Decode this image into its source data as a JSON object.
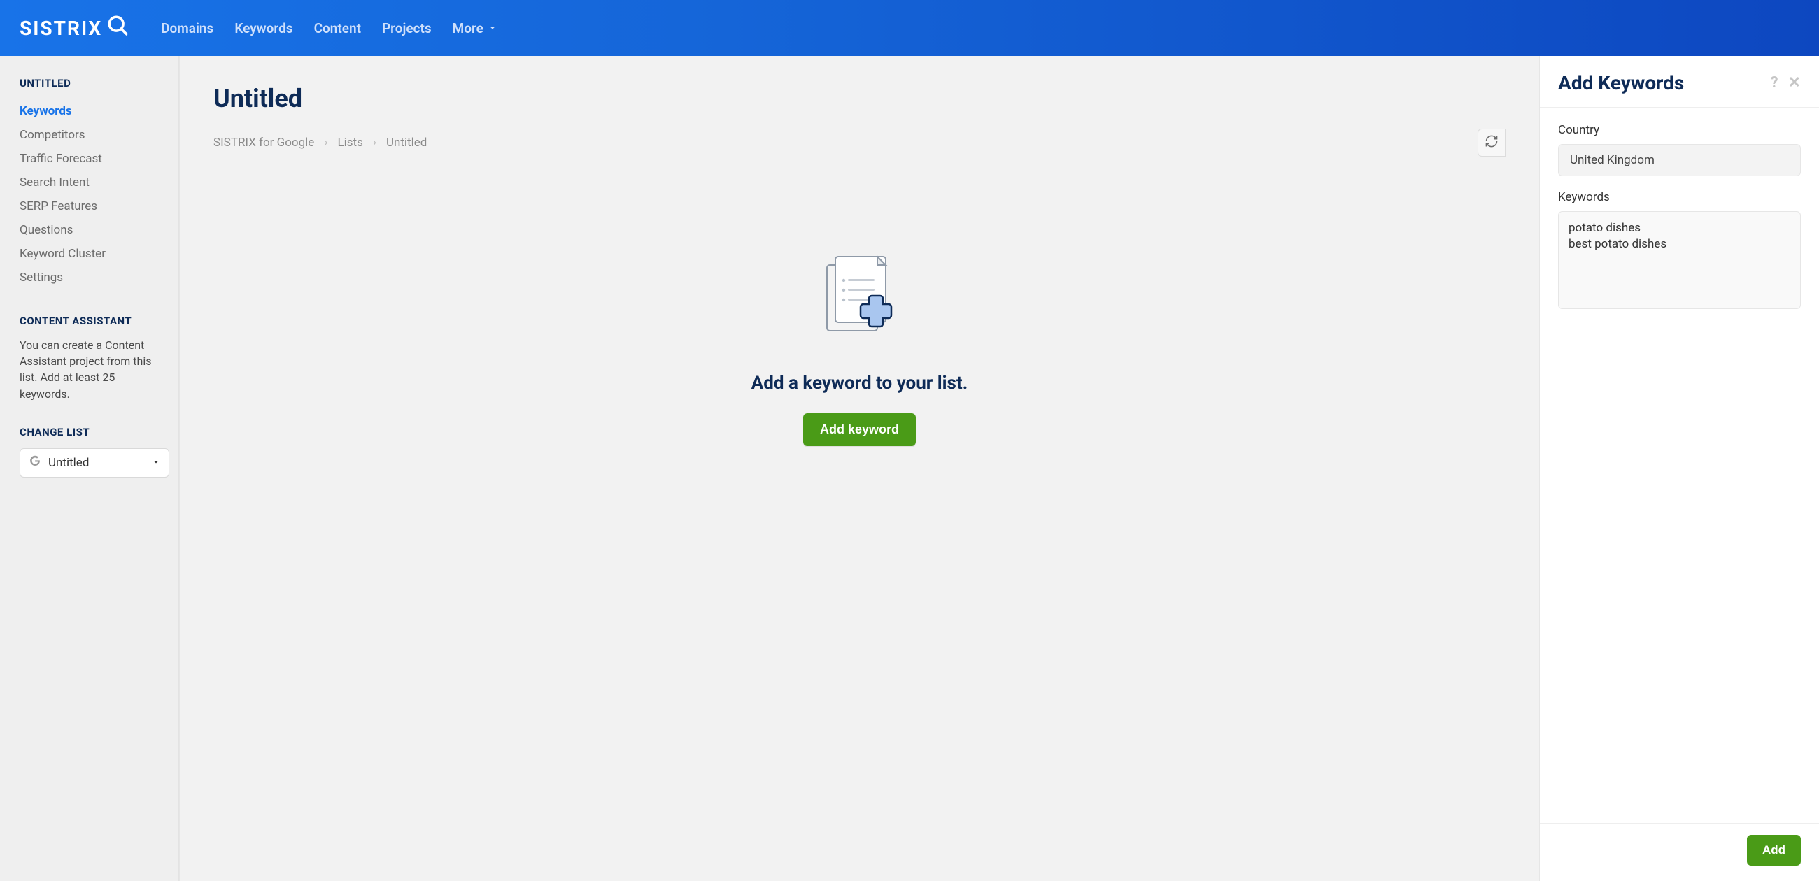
{
  "brand": "SISTRIX",
  "topnav": {
    "domains": "Domains",
    "keywords": "Keywords",
    "content": "Content",
    "projects": "Projects",
    "more": "More"
  },
  "sidebar": {
    "list_title": "UNTITLED",
    "nav": {
      "keywords": "Keywords",
      "competitors": "Competitors",
      "traffic_forecast": "Traffic Forecast",
      "search_intent": "Search Intent",
      "serp_features": "SERP Features",
      "questions": "Questions",
      "keyword_cluster": "Keyword Cluster",
      "settings": "Settings"
    },
    "content_assistant_title": "CONTENT ASSISTANT",
    "content_assistant_text": "You can create a Content Assistant project from this list. Add at least 25 keywords.",
    "change_list_title": "CHANGE LIST",
    "change_list_selected": "Untitled"
  },
  "main": {
    "title": "Untitled",
    "breadcrumb": {
      "a": "SISTRIX for Google",
      "b": "Lists",
      "c": "Untitled"
    },
    "empty_text": "Add a keyword to your list.",
    "add_keyword_btn": "Add keyword"
  },
  "panel": {
    "title": "Add Keywords",
    "country_label": "Country",
    "country_value": "United Kingdom",
    "keywords_label": "Keywords",
    "keywords_value": "potato dishes\nbest potato dishes",
    "add_btn": "Add"
  }
}
